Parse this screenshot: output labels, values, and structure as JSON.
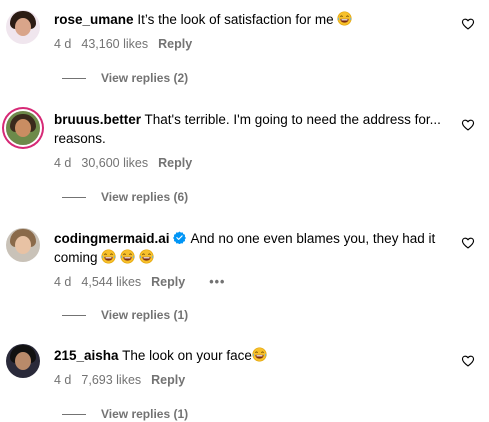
{
  "comments": [
    {
      "username": "rose_umane",
      "text": "It’s the look of satisfaction for me",
      "age": "4 d",
      "likes": "43,160 likes",
      "reply_label": "Reply",
      "view_replies": "View replies (2)",
      "emoji_icons": [
        "laughing-face-icon"
      ]
    },
    {
      "username": "bruuus.better",
      "text": "That's terrible. I'm going to need the address for... reasons.",
      "age": "4 d",
      "likes": "30,600 likes",
      "reply_label": "Reply",
      "view_replies": "View replies (6)",
      "avatar_ring": true
    },
    {
      "username": "codingmermaid.ai",
      "verified": true,
      "text": "And no one even blames you, they had it coming",
      "age": "4 d",
      "likes": "4,544 likes",
      "reply_label": "Reply",
      "more_label": "•••",
      "view_replies": "View replies (1)",
      "emoji_icons": [
        "laughing-face-icon",
        "laughing-face-icon",
        "laughing-face-icon"
      ]
    },
    {
      "username": "215_aisha",
      "text": "The look on your face",
      "age": "4 d",
      "likes": "7,693 likes",
      "reply_label": "Reply",
      "view_replies": "View replies (1)",
      "emoji_icons": [
        "laughing-face-icon"
      ]
    }
  ],
  "colors": {
    "secondary_text": "#737373",
    "verified_blue": "#0095f6",
    "story_ring": "#d62976"
  }
}
